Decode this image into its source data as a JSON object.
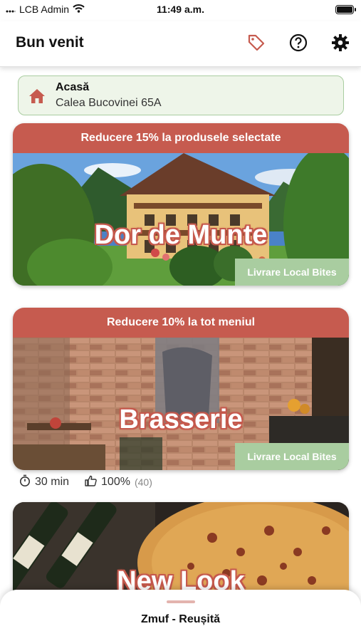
{
  "status_bar": {
    "carrier": "LCB Admin",
    "time": "11:49 a.m."
  },
  "header": {
    "title": "Bun venit"
  },
  "address": {
    "name": "Acasă",
    "street": "Calea Bucovinei 65A"
  },
  "restaurants": [
    {
      "name": "Dor de Munte",
      "promo": "Reducere 15% la produsele selectate",
      "delivery": "Livrare Local Bites"
    },
    {
      "name": "Brasserie",
      "promo": "Reducere 10% la tot meniul",
      "delivery": "Livrare Local Bites",
      "meta": {
        "time": "30 min",
        "rating": "100%",
        "count": "(40)"
      }
    },
    {
      "name": "New Look"
    }
  ],
  "bottom_sheet": {
    "label": "Zmuf - Reușită"
  },
  "colors": {
    "accent": "#c65b4f",
    "green": "#a9cda0"
  }
}
